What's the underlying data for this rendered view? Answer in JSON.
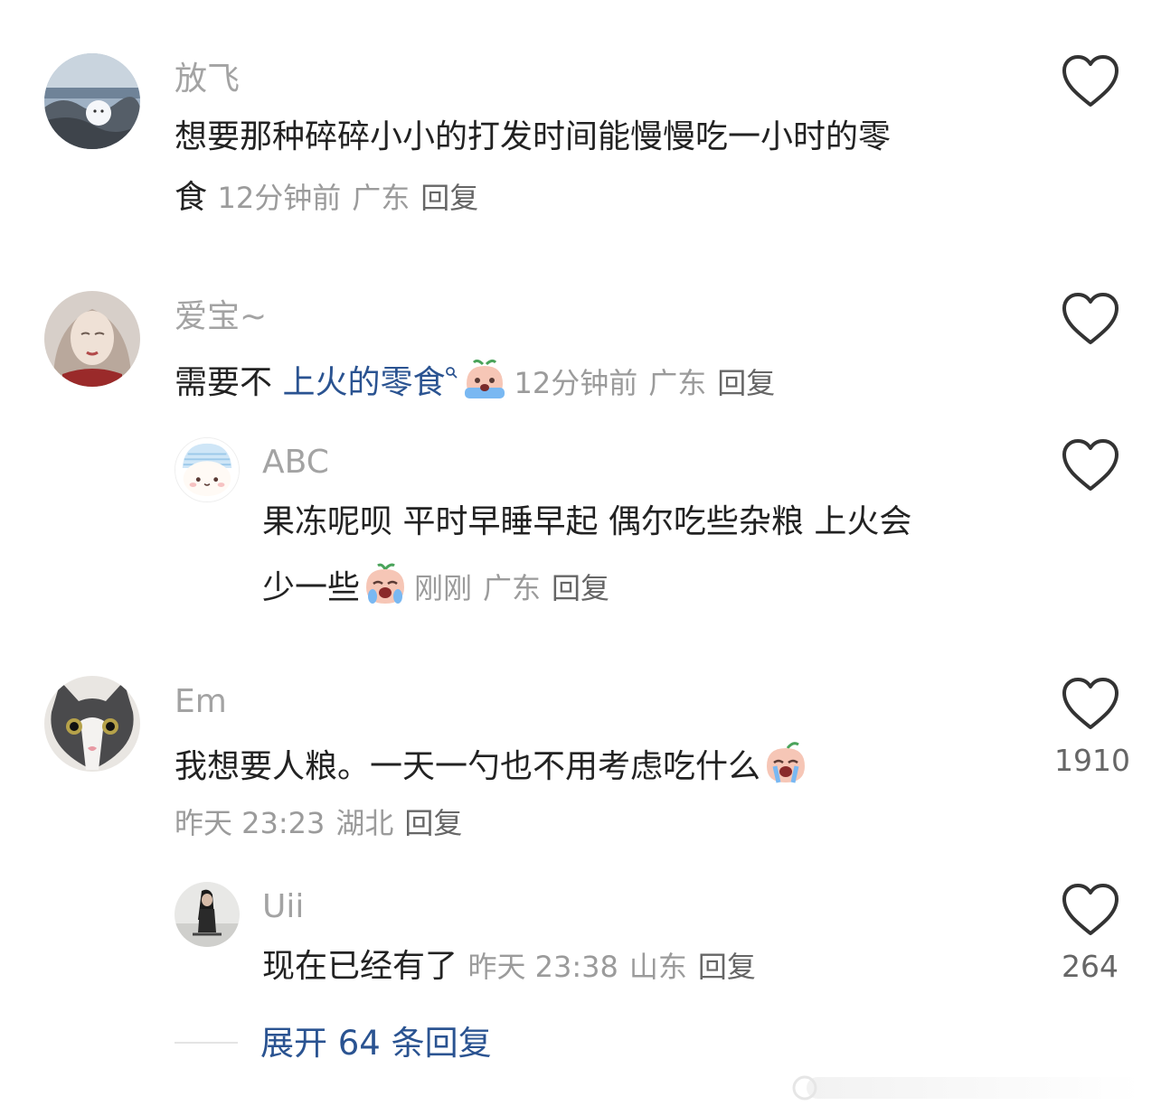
{
  "comments": [
    {
      "username": "放飞",
      "text_line1": "想要那种碎碎小小的打发时间能慢慢吃一小时的零",
      "text_line2": "食",
      "time": "12分钟前",
      "location": "广东",
      "reply": "回复"
    },
    {
      "username": "爱宝~",
      "text_prefix": "需要不 ",
      "text_link": "上火的零食",
      "time": "12分钟前",
      "location": "广东",
      "reply": "回复",
      "replies": [
        {
          "username": "ABC",
          "text_line1": "果冻呢呗 平时早睡早起 偶尔吃些杂粮 上火会",
          "text_line2": "少一些",
          "time": "刚刚",
          "location": "广东",
          "reply": "回复"
        }
      ]
    },
    {
      "username": "Em",
      "text": "我想要人粮。一天一勺也不用考虑吃什么",
      "likes": "1910",
      "time": "昨天 23:23",
      "location": "湖北",
      "reply": "回复",
      "replies": [
        {
          "username": "Uii",
          "text": "现在已经有了",
          "time": "昨天 23:38",
          "location": "山东",
          "reply": "回复",
          "likes": "264"
        }
      ]
    }
  ],
  "expand_replies": "展开 64 条回复",
  "icons": {
    "like": "heart-outline-icon",
    "emoji_crying": "crying-peach-emoji",
    "search": "search-small-icon"
  },
  "colors": {
    "link": "#2a5391",
    "username": "#a3a3a3",
    "meta": "#9b9b9b",
    "text": "#222222"
  }
}
